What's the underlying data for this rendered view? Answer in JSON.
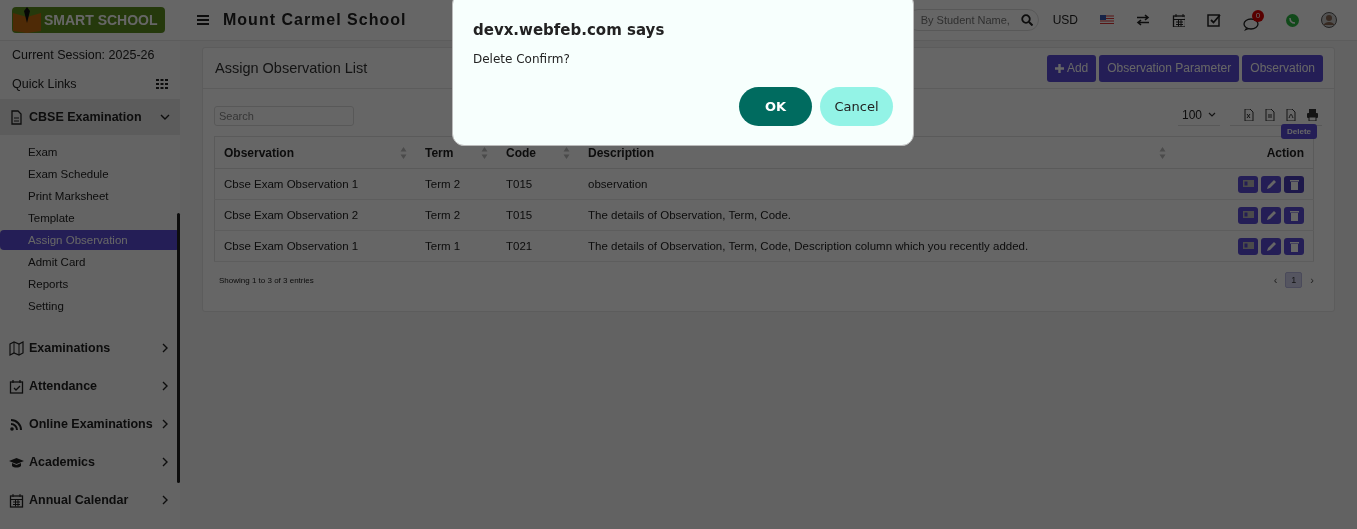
{
  "header": {
    "logo_text": "SMART SCHOOL",
    "school_name": "Mount Carmel School",
    "search": {
      "placeholder": "By Student Name,"
    },
    "currency": "USD",
    "chat_badge": "0"
  },
  "sidebar": {
    "session": "Current Session: 2025-26",
    "quick_links": "Quick Links",
    "menu": [
      {
        "label": "CBSE Examination",
        "expanded": true,
        "children": [
          {
            "label": "Exam",
            "selected": false
          },
          {
            "label": "Exam Schedule",
            "selected": false
          },
          {
            "label": "Print Marksheet",
            "selected": false
          },
          {
            "label": "Template",
            "selected": false
          },
          {
            "label": "Assign Observation",
            "selected": true
          },
          {
            "label": "Admit Card",
            "selected": false
          },
          {
            "label": "Reports",
            "selected": false
          },
          {
            "label": "Setting",
            "selected": false
          }
        ]
      },
      {
        "label": "Examinations",
        "expanded": false
      },
      {
        "label": "Attendance",
        "expanded": false
      },
      {
        "label": "Online Examinations",
        "expanded": false
      },
      {
        "label": "Academics",
        "expanded": false
      },
      {
        "label": "Annual Calendar",
        "expanded": false
      }
    ]
  },
  "card": {
    "title": "Assign Observation List",
    "buttons": [
      {
        "label": "Add",
        "kind": "add"
      },
      {
        "label": "Observation Parameter",
        "kind": "plain"
      },
      {
        "label": "Observation",
        "kind": "plain"
      }
    ],
    "search": {
      "placeholder": "Search"
    },
    "page_size": "100",
    "table": {
      "columns": [
        "Observation",
        "Term",
        "Code",
        "Description",
        "Action"
      ],
      "rows": [
        [
          "Cbse Exam Observation 1",
          "Term 2",
          "T015",
          "observation"
        ],
        [
          "Cbse Exam Observation 2",
          "Term 2",
          "T015",
          "The details of Observation, Term, Code."
        ],
        [
          "Cbse Exam Observation 1",
          "Term 1",
          "T021",
          "The details of Observation, Term, Code, Description column which you recently added."
        ]
      ]
    },
    "tooltip": "Delete",
    "info": "Showing 1 to 3 of 3 entries",
    "pagination": {
      "prev": "‹",
      "pages": [
        {
          "label": "1",
          "selected": true
        }
      ],
      "next": "›"
    }
  },
  "dialog": {
    "title": "devx.webfeb.com says",
    "message": "Delete Confirm?",
    "ok": "OK",
    "cancel": "Cancel"
  }
}
